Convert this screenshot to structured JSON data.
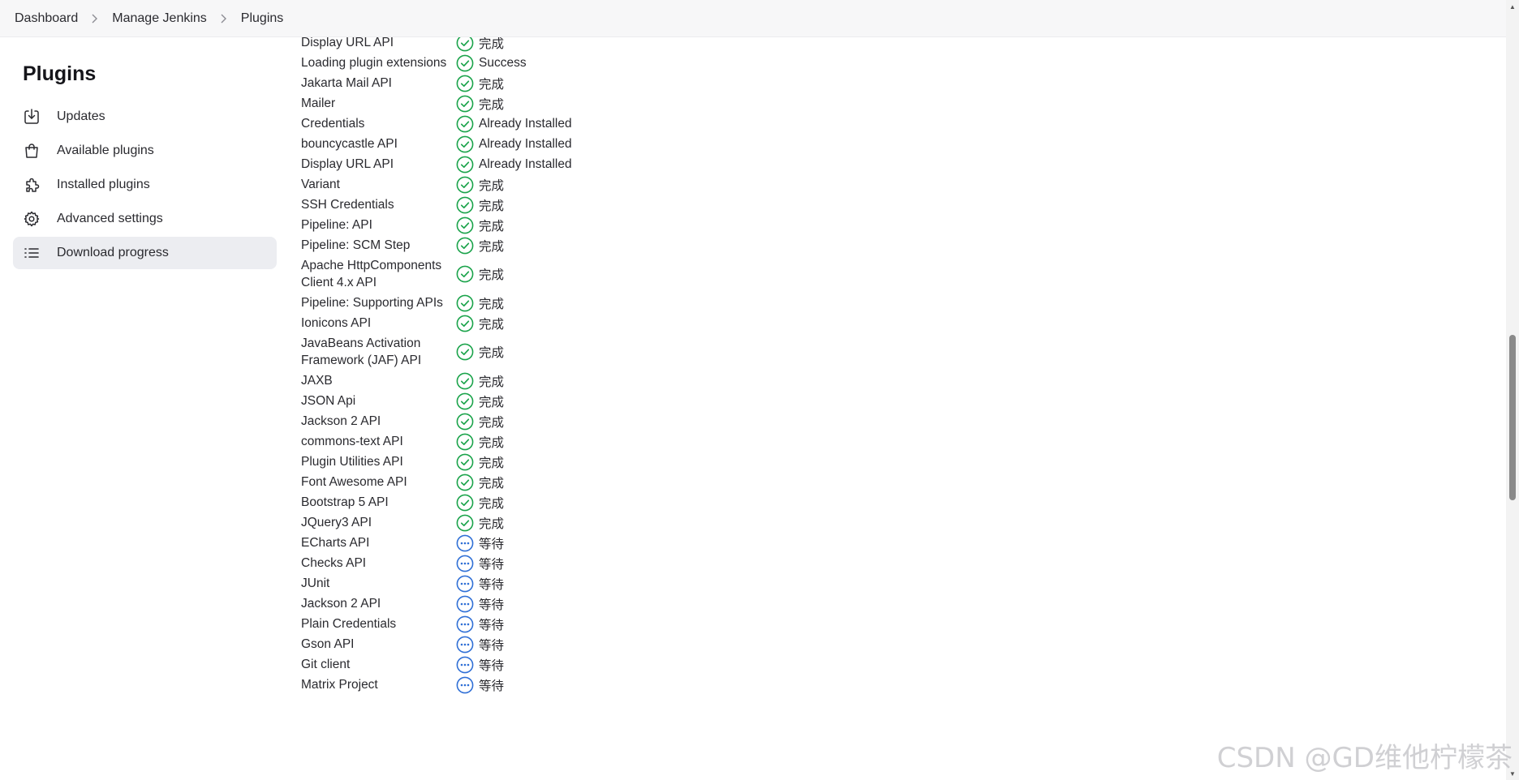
{
  "breadcrumb": [
    "Dashboard",
    "Manage Jenkins",
    "Plugins"
  ],
  "sidebar": {
    "title": "Plugins",
    "items": [
      {
        "label": "Updates",
        "icon": "download-icon",
        "active": false
      },
      {
        "label": "Available plugins",
        "icon": "shopping-bag-icon",
        "active": false
      },
      {
        "label": "Installed plugins",
        "icon": "puzzle-icon",
        "active": false
      },
      {
        "label": "Advanced settings",
        "icon": "gear-icon",
        "active": false
      },
      {
        "label": "Download progress",
        "icon": "list-icon",
        "active": true
      }
    ]
  },
  "progress": {
    "rows": [
      {
        "name": "Display URL API",
        "status": "完成",
        "state": "done"
      },
      {
        "name": "Loading plugin extensions",
        "status": "Success",
        "state": "done"
      },
      {
        "name": "Jakarta Mail API",
        "status": "完成",
        "state": "done"
      },
      {
        "name": "Mailer",
        "status": "完成",
        "state": "done"
      },
      {
        "name": "Credentials",
        "status": "Already Installed",
        "state": "done"
      },
      {
        "name": "bouncycastle API",
        "status": "Already Installed",
        "state": "done"
      },
      {
        "name": "Display URL API",
        "status": "Already Installed",
        "state": "done"
      },
      {
        "name": "Variant",
        "status": "完成",
        "state": "done"
      },
      {
        "name": "SSH Credentials",
        "status": "完成",
        "state": "done"
      },
      {
        "name": "Pipeline: API",
        "status": "完成",
        "state": "done"
      },
      {
        "name": "Pipeline: SCM Step",
        "status": "完成",
        "state": "done"
      },
      {
        "name": "Apache HttpComponents Client 4.x API",
        "status": "完成",
        "state": "done"
      },
      {
        "name": "Pipeline: Supporting APIs",
        "status": "完成",
        "state": "done"
      },
      {
        "name": "Ionicons API",
        "status": "完成",
        "state": "done"
      },
      {
        "name": "JavaBeans Activation Framework (JAF) API",
        "status": "完成",
        "state": "done"
      },
      {
        "name": "JAXB",
        "status": "完成",
        "state": "done"
      },
      {
        "name": "JSON Api",
        "status": "完成",
        "state": "done"
      },
      {
        "name": "Jackson 2 API",
        "status": "完成",
        "state": "done"
      },
      {
        "name": "commons-text API",
        "status": "完成",
        "state": "done"
      },
      {
        "name": "Plugin Utilities API",
        "status": "完成",
        "state": "done"
      },
      {
        "name": "Font Awesome API",
        "status": "完成",
        "state": "done"
      },
      {
        "name": "Bootstrap 5 API",
        "status": "完成",
        "state": "done"
      },
      {
        "name": "JQuery3 API",
        "status": "完成",
        "state": "done"
      },
      {
        "name": "ECharts API",
        "status": "等待",
        "state": "pending"
      },
      {
        "name": "Checks API",
        "status": "等待",
        "state": "pending"
      },
      {
        "name": "JUnit",
        "status": "等待",
        "state": "pending"
      },
      {
        "name": "Jackson 2 API",
        "status": "等待",
        "state": "pending"
      },
      {
        "name": "Plain Credentials",
        "status": "等待",
        "state": "pending"
      },
      {
        "name": "Gson API",
        "status": "等待",
        "state": "pending"
      },
      {
        "name": "Git client",
        "status": "等待",
        "state": "pending"
      },
      {
        "name": "Matrix Project",
        "status": "等待",
        "state": "pending"
      }
    ]
  },
  "colors": {
    "done": "#1aa34a",
    "pending": "#2f6fd6"
  },
  "watermark": "CSDN @GD维他柠檬茶"
}
